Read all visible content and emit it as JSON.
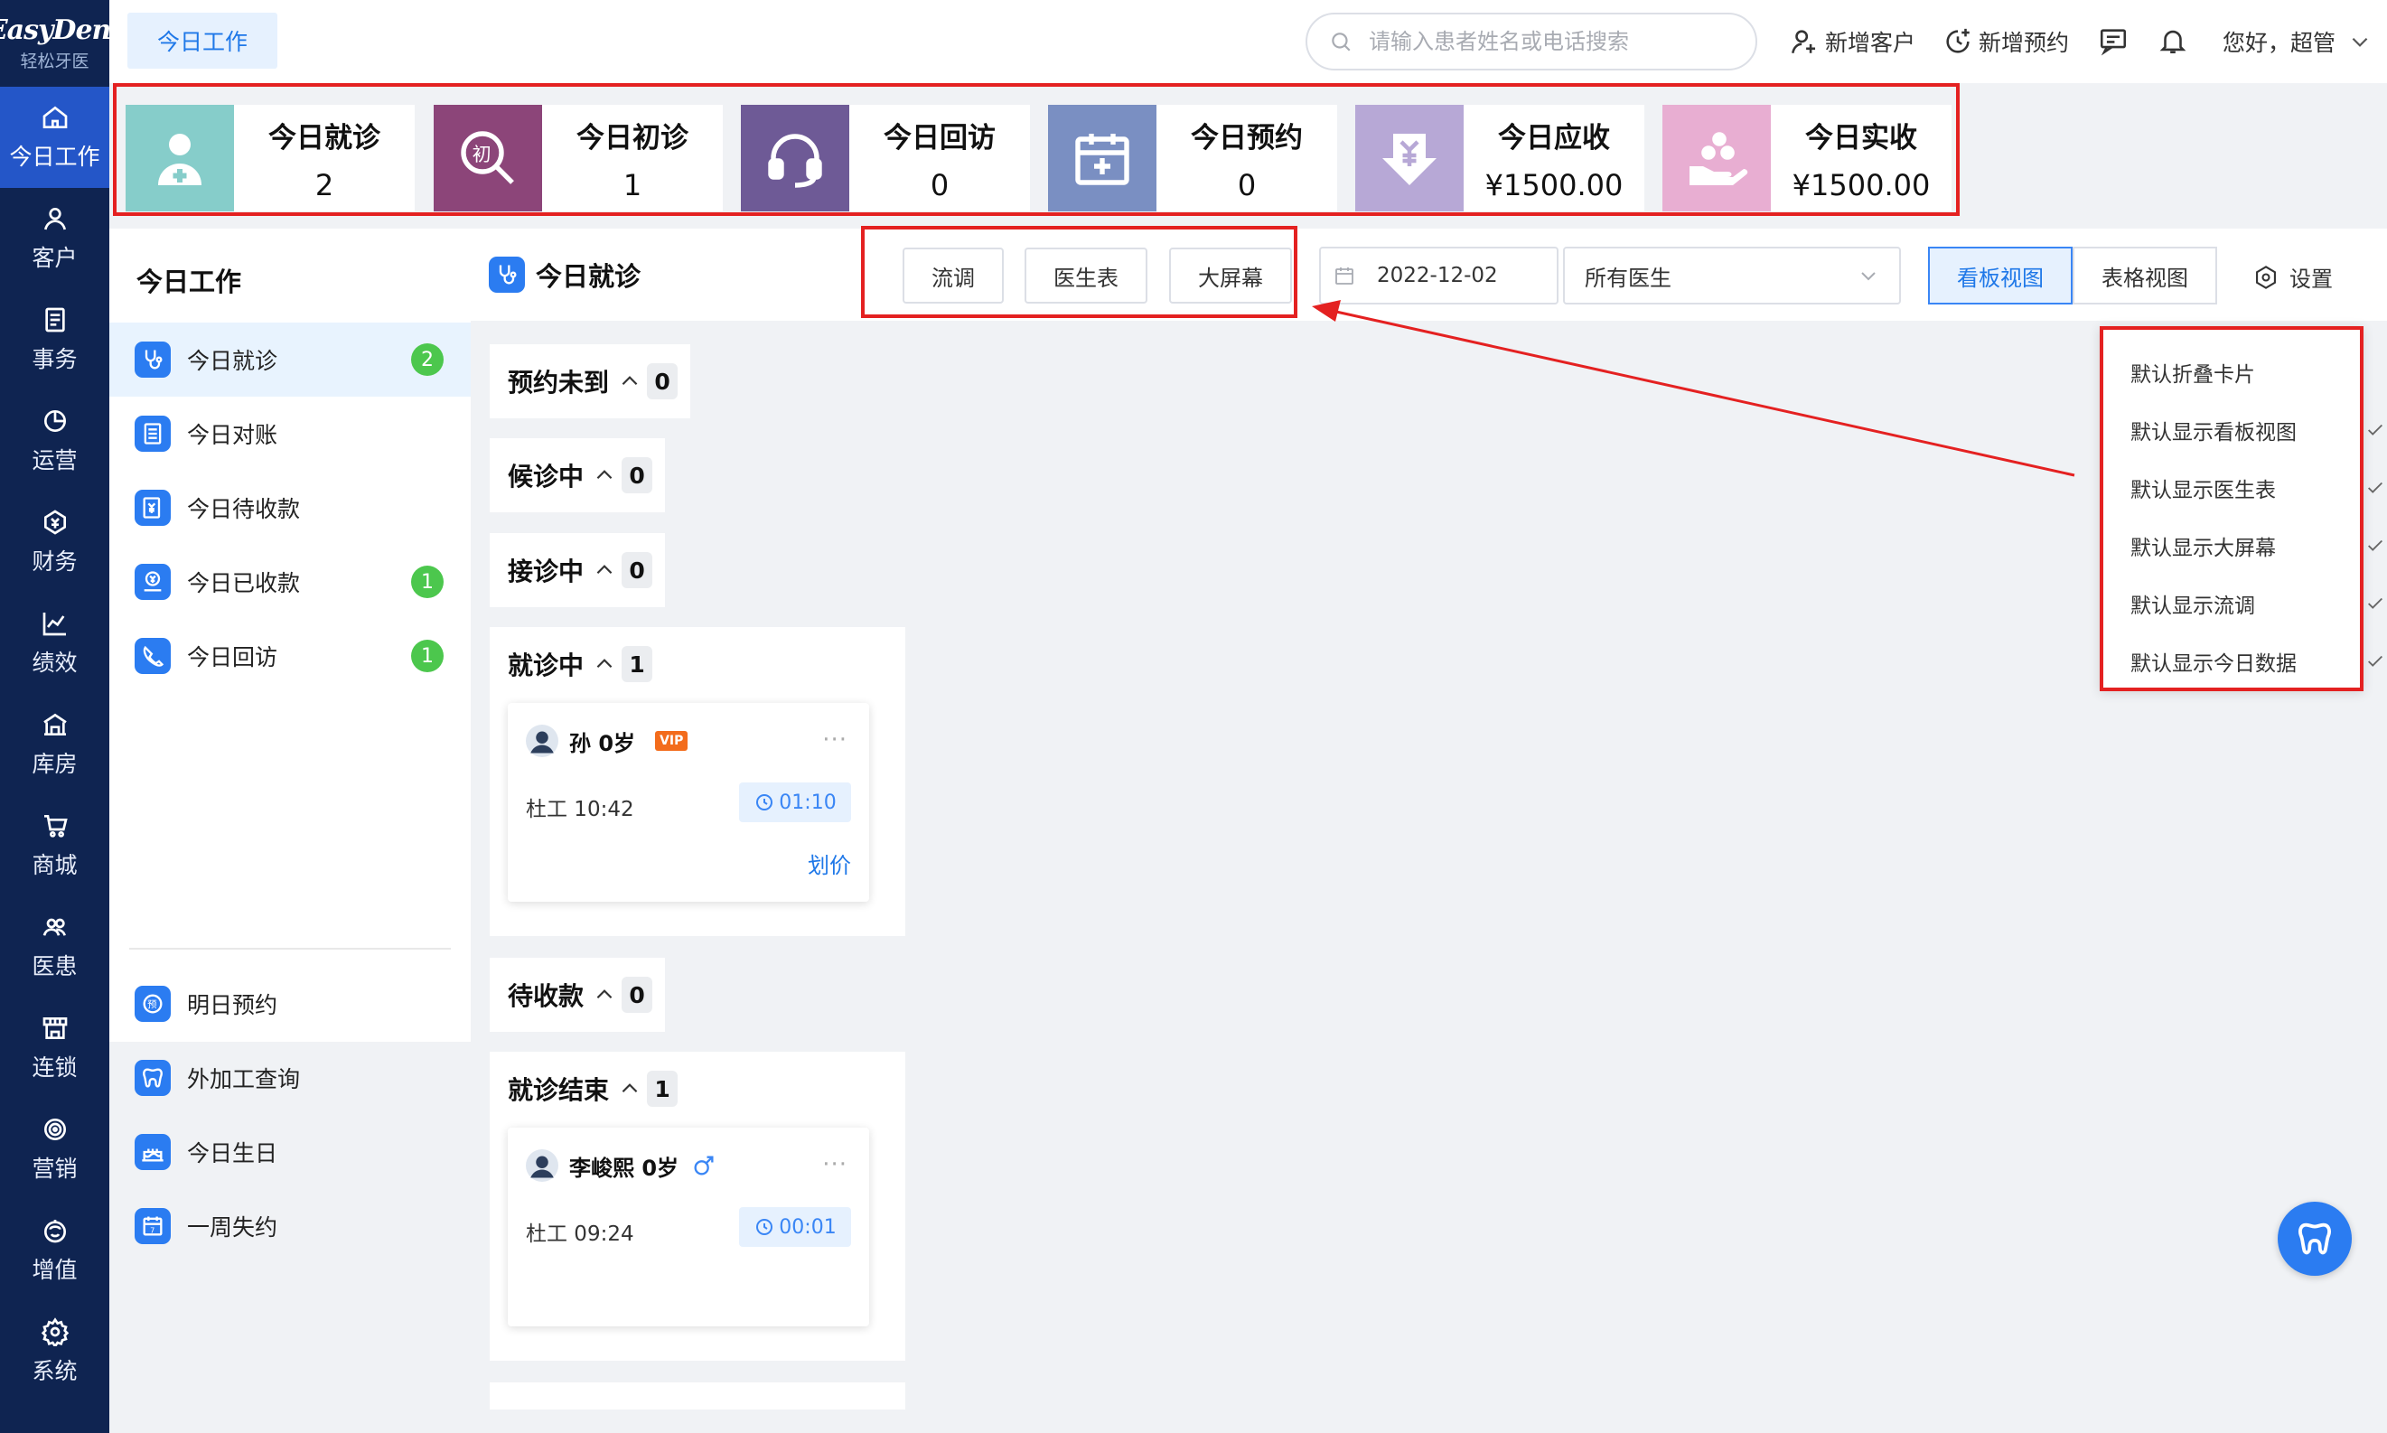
{
  "logo": {
    "main": "EasyDent",
    "sub": "轻松牙医"
  },
  "nav": [
    {
      "label": "今日工作",
      "icon": "home-icon"
    },
    {
      "label": "客户",
      "icon": "user-icon"
    },
    {
      "label": "事务",
      "icon": "task-icon"
    },
    {
      "label": "运营",
      "icon": "pie-icon"
    },
    {
      "label": "财务",
      "icon": "finance-icon"
    },
    {
      "label": "绩效",
      "icon": "chart-icon"
    },
    {
      "label": "库房",
      "icon": "warehouse-icon"
    },
    {
      "label": "商城",
      "icon": "cart-icon"
    },
    {
      "label": "医患",
      "icon": "people-icon"
    },
    {
      "label": "连锁",
      "icon": "store-icon"
    },
    {
      "label": "营销",
      "icon": "target-icon"
    },
    {
      "label": "增值",
      "icon": "gift-icon"
    },
    {
      "label": "系统",
      "icon": "gear-icon"
    }
  ],
  "topbar": {
    "tab": "今日工作",
    "search_placeholder": "请输入患者姓名或电话搜索",
    "add_customer": "新增客户",
    "add_appointment": "新增预约",
    "greeting": "您好，超管"
  },
  "stats": [
    {
      "label": "今日就诊",
      "value": "2",
      "color": "#86cdca"
    },
    {
      "label": "今日初诊",
      "value": "1",
      "color": "#8c4579"
    },
    {
      "label": "今日回访",
      "value": "0",
      "color": "#6e5a96"
    },
    {
      "label": "今日预约",
      "value": "0",
      "color": "#7a8fc2"
    },
    {
      "label": "今日应收",
      "value": "¥1500.00",
      "color": "#b7a8d6"
    },
    {
      "label": "今日实收",
      "value": "¥1500.00",
      "color": "#e8aed2"
    }
  ],
  "submenu": {
    "title": "今日工作",
    "items": [
      {
        "label": "今日就诊",
        "badge": "2",
        "icon": "stethoscope-icon"
      },
      {
        "label": "今日对账",
        "badge": "",
        "icon": "ledger-icon"
      },
      {
        "label": "今日待收款",
        "badge": "",
        "icon": "pending-payment-icon"
      },
      {
        "label": "今日已收款",
        "badge": "1",
        "icon": "received-payment-icon"
      },
      {
        "label": "今日回访",
        "badge": "1",
        "icon": "followup-icon"
      },
      {
        "label": "明日预约",
        "badge": "",
        "icon": "appointment-icon"
      },
      {
        "label": "外加工查询",
        "badge": "",
        "icon": "tooth-icon"
      },
      {
        "label": "今日生日",
        "badge": "",
        "icon": "cake-icon"
      },
      {
        "label": "一周失约",
        "badge": "",
        "icon": "calendar-icon"
      }
    ]
  },
  "main": {
    "title": "今日就诊",
    "buttons": [
      "流调",
      "医生表",
      "大屏幕"
    ],
    "date": "2022-12-02",
    "doctor_select": "所有医生",
    "views": [
      "看板视图",
      "表格视图"
    ],
    "settings": "设置"
  },
  "columns": [
    {
      "title": "预约未到",
      "count": "0"
    },
    {
      "title": "候诊中",
      "count": "0"
    },
    {
      "title": "接诊中",
      "count": "0"
    },
    {
      "title": "就诊中",
      "count": "1"
    },
    {
      "title": "待收款",
      "count": "0"
    },
    {
      "title": "就诊结束",
      "count": "1"
    }
  ],
  "cards": [
    {
      "name": "孙 0岁",
      "tag": "VIP",
      "doctor_time": "杜工  10:42",
      "timer": "01:10",
      "action": "划价"
    },
    {
      "name": "李峻熙 0岁",
      "tag": "",
      "doctor_time": "杜工  09:24",
      "timer": "00:01",
      "action": ""
    }
  ],
  "dropdown": [
    {
      "label": "默认折叠卡片",
      "checked": false
    },
    {
      "label": "默认显示看板视图",
      "checked": true
    },
    {
      "label": "默认显示医生表",
      "checked": true
    },
    {
      "label": "默认显示大屏幕",
      "checked": true
    },
    {
      "label": "默认显示流调",
      "checked": true
    },
    {
      "label": "默认显示今日数据",
      "checked": true
    }
  ],
  "colors": {
    "nav_bg": "#0f2451",
    "nav_active": "#2456c8",
    "accent": "#1f78e8",
    "annotation": "#e42121",
    "badge": "#4cc74d"
  }
}
